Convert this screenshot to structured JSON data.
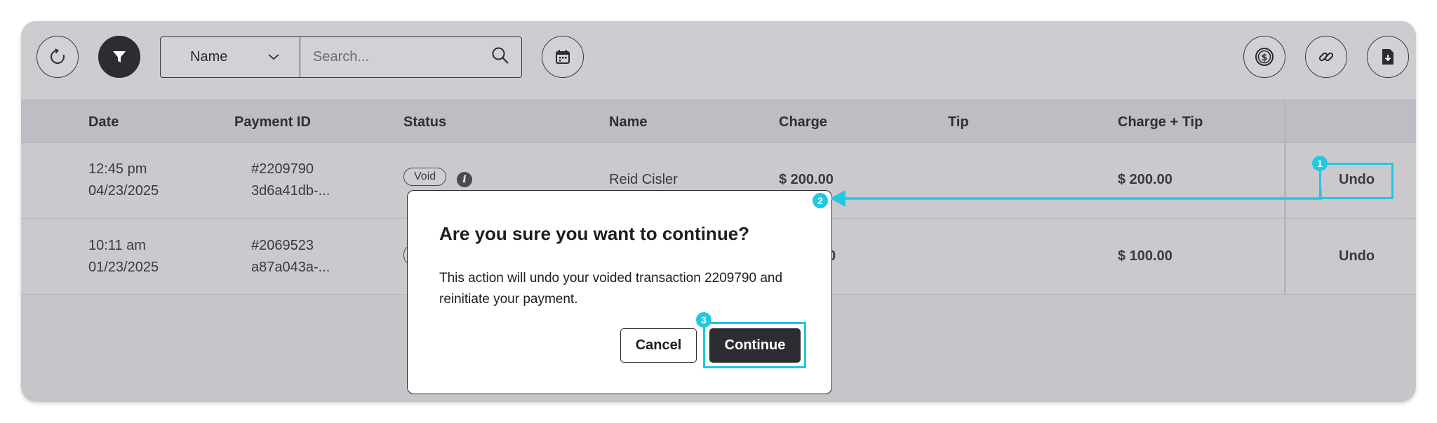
{
  "toolbar": {
    "refresh_icon": "refresh-icon",
    "filter_icon": "filter-icon",
    "search_field_select": "Name",
    "search_placeholder": "Search...",
    "calendar_icon": "calendar-icon",
    "right_icons": [
      "dollar-coin-icon",
      "link-icon",
      "download-file-icon"
    ]
  },
  "table": {
    "headers": [
      "Date",
      "Payment ID",
      "Status",
      "Name",
      "Charge",
      "Tip",
      "Charge + Tip"
    ],
    "rows": [
      {
        "time": "12:45 pm",
        "date": "04/23/2025",
        "payment_id": "#2209790",
        "payment_hash": "3d6a41db-...",
        "status": "Void",
        "name": "Reid Cisler",
        "charge": "$ 200.00",
        "tip": "",
        "charge_tip": "$ 200.00",
        "action": "Undo"
      },
      {
        "time": "10:11 am",
        "date": "01/23/2025",
        "payment_id": "#2069523",
        "payment_hash": "a87a043a-...",
        "status": "",
        "name": "",
        "charge": "0",
        "tip": "",
        "charge_tip": "$ 100.00",
        "action": "Undo"
      }
    ]
  },
  "modal": {
    "title": "Are you sure you want to continue?",
    "body": "This action will undo your voided transaction 2209790 and reinitiate your payment.",
    "cancel_label": "Cancel",
    "continue_label": "Continue"
  },
  "annotations": [
    "1",
    "2",
    "3"
  ],
  "colors": {
    "annotation": "#22c8e0",
    "dark_button": "#2d2d31",
    "panel": "#c5c5ca"
  }
}
